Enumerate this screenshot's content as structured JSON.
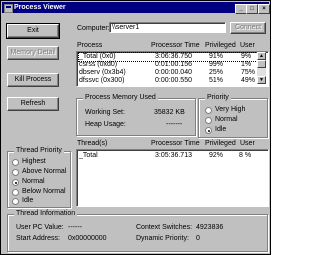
{
  "window": {
    "title": "Process Viewer"
  },
  "buttons": {
    "exit": "Exit",
    "memory_detail": "Memory Detail",
    "kill_process": "Kill Process",
    "refresh": "Refresh",
    "connect": "Connect"
  },
  "computer": {
    "label": "Computer:",
    "value": "\\\\server1"
  },
  "process_list": {
    "headers": {
      "name": "Process",
      "time": "Processor Time",
      "privileged": "Privileged",
      "user": "User"
    },
    "rows": [
      {
        "name": "_Total (0x0)",
        "time": "3:06:36.750",
        "privileged": "91%",
        "user": "9%"
      },
      {
        "name": "csrss (0xd0)",
        "time": "0:01:00.156",
        "privileged": "99%",
        "user": "1%"
      },
      {
        "name": "dbserv (0x3b4)",
        "time": "0:00:00.040",
        "privileged": "25%",
        "user": "75%"
      },
      {
        "name": "dfssvc (0x300)",
        "time": "0:00:00.550",
        "privileged": "51%",
        "user": "49%"
      }
    ]
  },
  "memory": {
    "title": "Process Memory Used",
    "working_set_label": "Working Set:",
    "working_set_value": "35832 KB",
    "heap_label": "Heap Usage:",
    "heap_value": "-------"
  },
  "priority": {
    "title": "Priority",
    "options": [
      "Very High",
      "Normal",
      "Idle"
    ],
    "selected": "Idle"
  },
  "thread_priority": {
    "title": "Thread Priority",
    "options": [
      "Highest",
      "Above Normal",
      "Normal",
      "Below Normal",
      "Idle"
    ],
    "selected": "Normal"
  },
  "thread_list": {
    "headers": {
      "name": "Thread(s)",
      "time": "Processor Time",
      "privileged": "Privileged",
      "user": "User"
    },
    "rows": [
      {
        "name": "_Total",
        "time": "3:05:36.713",
        "privileged": "92%",
        "user": "8 %"
      }
    ]
  },
  "thread_info": {
    "title": "Thread Information",
    "user_pc_label": "User PC Value:",
    "user_pc_value": "------",
    "start_label": "Start Address:",
    "start_value": "0x00000000",
    "ctx_label": "Context Switches:",
    "ctx_value": "4923836",
    "dyn_label": "Dynamic Priority:",
    "dyn_value": "0"
  }
}
